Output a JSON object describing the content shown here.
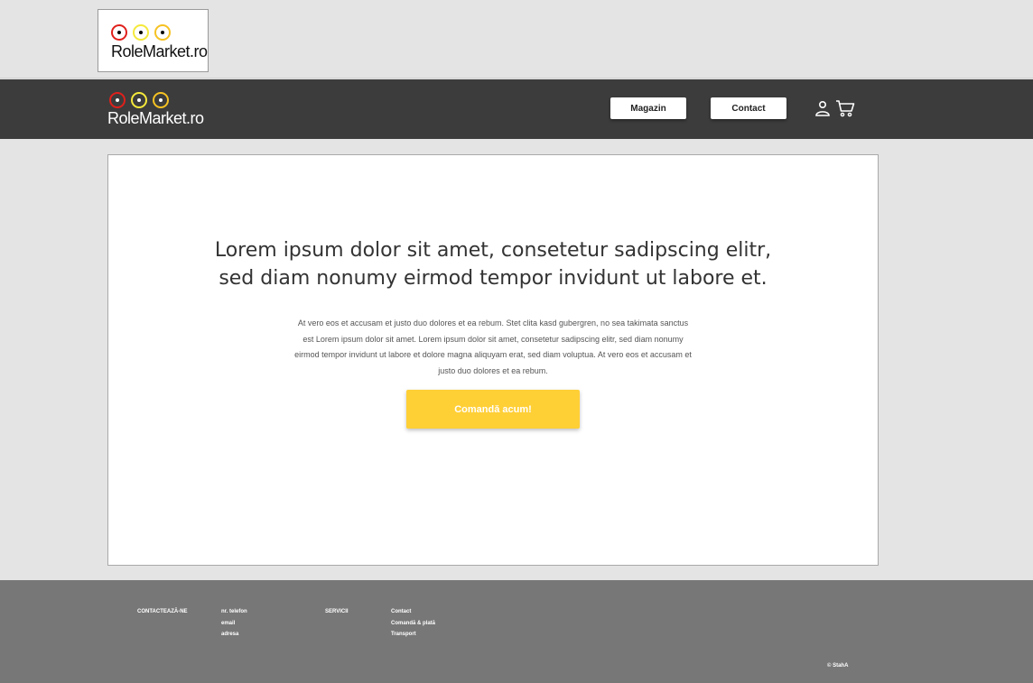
{
  "brand": {
    "logo_text": "RoleMarket.ro"
  },
  "nav": {
    "magazin": "Magazin",
    "contact": "Contact"
  },
  "hero": {
    "headline": "Lorem ipsum dolor sit amet, consetetur sadipscing elitr, sed diam nonumy eirmod tempor invidunt ut labore et.",
    "body": "At vero eos et accusam et justo duo dolores et ea rebum. Stet clita kasd gubergren, no sea takimata sanctus est Lorem ipsum dolor sit amet. Lorem ipsum dolor sit amet, consetetur sadipscing elitr, sed diam nonumy eirmod tempor invidunt ut labore et dolore magna aliquyam erat, sed diam voluptua. At vero eos et accusam et justo duo dolores et ea rebum.",
    "cta": "Comandă acum!"
  },
  "footer": {
    "contact_heading": "CONTACTEAZĂ-NE",
    "contact_items": [
      "nr. telefon",
      "email",
      "adresa"
    ],
    "services_heading": "SERVICII",
    "service_items": [
      "Contact",
      "Comandă & plată",
      "Transport"
    ],
    "copyright": "© StahA"
  },
  "colors": {
    "accent": "#ffcf36",
    "nav_bg": "#3c3c3c",
    "footer_bg": "#777777",
    "page_bg": "#e4e4e4"
  }
}
